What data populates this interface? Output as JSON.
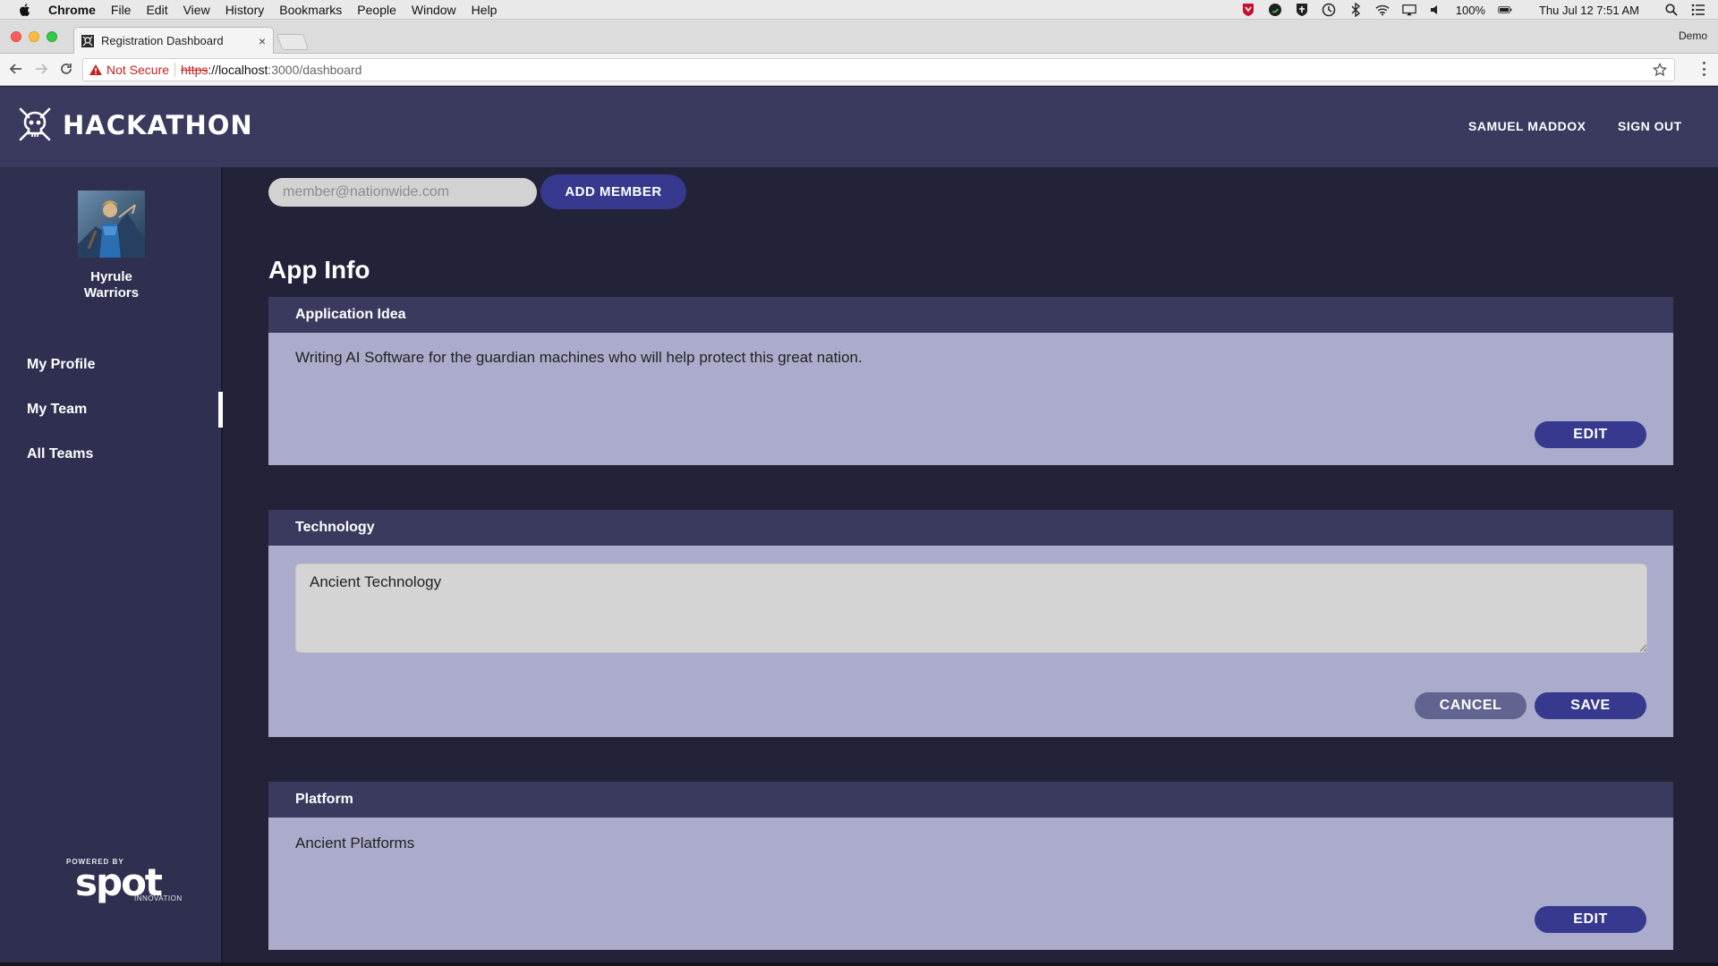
{
  "os_menubar": {
    "app": "Chrome",
    "items": [
      "File",
      "Edit",
      "View",
      "History",
      "Bookmarks",
      "People",
      "Window",
      "Help"
    ],
    "battery": "100%",
    "clock": "Thu Jul 12  7:51 AM"
  },
  "browser": {
    "tab_title": "Registration Dashboard",
    "tab_close": "×",
    "profile": "Demo",
    "security": "Not Secure",
    "url_scheme": "https",
    "url_host": "://localhost",
    "url_path": ":3000/dashboard"
  },
  "header": {
    "brand": "HACKATHON",
    "user_name": "SAMUEL MADDOX",
    "sign_out": "SIGN OUT"
  },
  "sidebar": {
    "team_name_line1": "Hyrule",
    "team_name_line2": "Warriors",
    "nav": [
      {
        "label": "My Profile",
        "active": false
      },
      {
        "label": "My Team",
        "active": true
      },
      {
        "label": "All Teams",
        "active": false
      }
    ],
    "powered_by": "POWERED BY",
    "powered_brand": "spot",
    "powered_sub": "INNOVATION"
  },
  "add_member": {
    "placeholder": "member@nationwide.com",
    "button": "ADD MEMBER"
  },
  "app_info": {
    "title": "App Info",
    "cards": [
      {
        "heading": "Application Idea",
        "value": "Writing AI Software for the guardian machines who will help protect this great nation.",
        "mode": "view",
        "edit": "EDIT"
      },
      {
        "heading": "Technology",
        "value": "Ancient Technology",
        "mode": "editing",
        "cancel": "CANCEL",
        "save": "SAVE"
      },
      {
        "heading": "Platform",
        "value": "Ancient Platforms",
        "mode": "view",
        "edit": "EDIT"
      }
    ]
  },
  "colors": {
    "header_bg": "#393a5e",
    "sidebar_bg": "#2f3050",
    "page_bg": "#222238",
    "card_bg": "#abaccb",
    "primary_button": "#36398e",
    "secondary_button": "#60648f"
  }
}
